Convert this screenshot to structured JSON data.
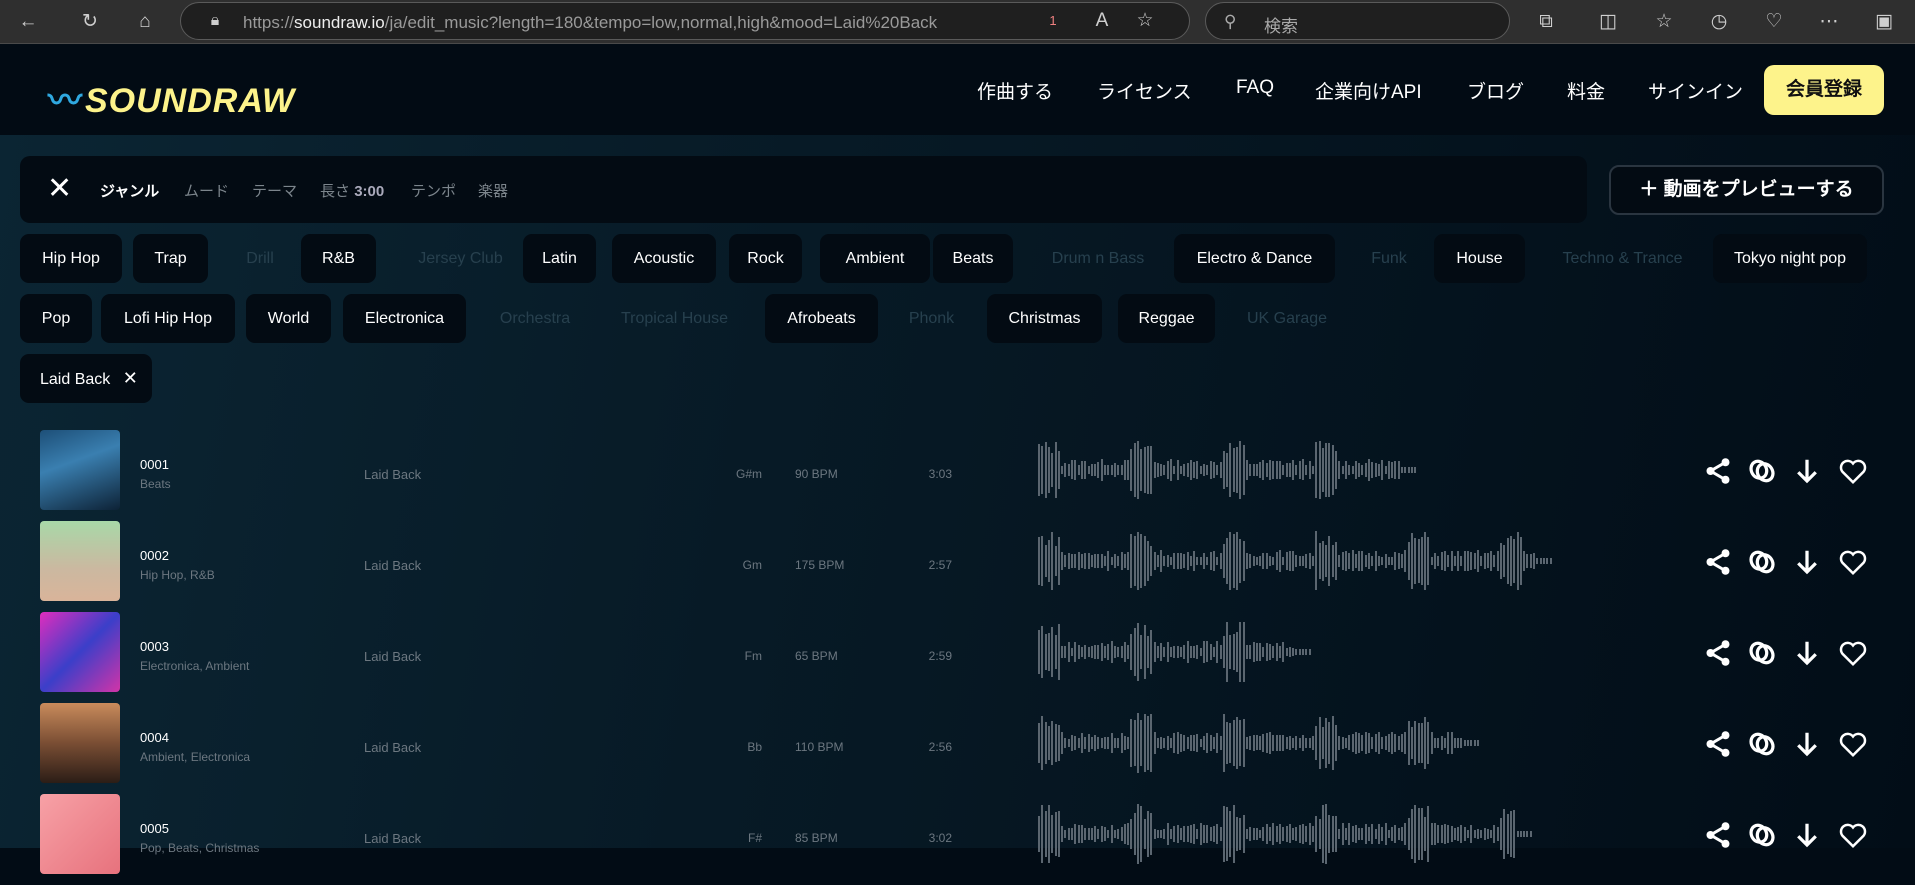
{
  "browser": {
    "url_host": "soundraw.io",
    "url_prefix": "https://",
    "url_path": "/ja/edit_music?length=180&tempo=low,normal,high&mood=Laid%20Back",
    "search_placeholder": "検索",
    "badge": "1"
  },
  "header": {
    "logo": "SOUNDRAW",
    "nav": [
      "作曲する",
      "ライセンス",
      "FAQ",
      "企業向けAPI",
      "ブログ",
      "料金",
      "サインイン"
    ],
    "signup": "会員登録",
    "accent": "#fdf38b"
  },
  "filters": {
    "tabs": [
      "ジャンル",
      "ムード",
      "テーマ",
      "長さ",
      "テンポ",
      "楽器"
    ],
    "length_value": "3:00",
    "preview": "動画をプレビューする"
  },
  "genres": [
    {
      "label": "Hip Hop",
      "enabled": true
    },
    {
      "label": "Trap",
      "enabled": true
    },
    {
      "label": "Drill",
      "enabled": false
    },
    {
      "label": "R&B",
      "enabled": true
    },
    {
      "label": "Jersey Club",
      "enabled": false
    },
    {
      "label": "Latin",
      "enabled": true
    },
    {
      "label": "Acoustic",
      "enabled": true
    },
    {
      "label": "Rock",
      "enabled": true
    },
    {
      "label": "Ambient",
      "enabled": true
    },
    {
      "label": "Beats",
      "enabled": true
    },
    {
      "label": "Drum n Bass",
      "enabled": false
    },
    {
      "label": "Electro & Dance",
      "enabled": true
    },
    {
      "label": "Funk",
      "enabled": false
    },
    {
      "label": "House",
      "enabled": true
    },
    {
      "label": "Techno & Trance",
      "enabled": false
    },
    {
      "label": "Tokyo night pop",
      "enabled": true
    },
    {
      "label": "Pop",
      "enabled": true
    },
    {
      "label": "Lofi Hip Hop",
      "enabled": true
    },
    {
      "label": "World",
      "enabled": true
    },
    {
      "label": "Electronica",
      "enabled": true
    },
    {
      "label": "Orchestra",
      "enabled": false
    },
    {
      "label": "Tropical House",
      "enabled": false
    },
    {
      "label": "Afrobeats",
      "enabled": true
    },
    {
      "label": "Phonk",
      "enabled": false
    },
    {
      "label": "Christmas",
      "enabled": true
    },
    {
      "label": "Reggae",
      "enabled": true
    },
    {
      "label": "UK Garage",
      "enabled": false
    }
  ],
  "selected_mood": "Laid Back",
  "tracks": [
    {
      "id": "0001",
      "genres": "Beats",
      "mood": "Laid Back",
      "key": "G#m",
      "bpm": "90 BPM",
      "duration": "3:03"
    },
    {
      "id": "0002",
      "genres": "Hip Hop, R&B",
      "mood": "Laid Back",
      "key": "Gm",
      "bpm": "175 BPM",
      "duration": "2:57"
    },
    {
      "id": "0003",
      "genres": "Electronica, Ambient",
      "mood": "Laid Back",
      "key": "Fm",
      "bpm": "65 BPM",
      "duration": "2:59"
    },
    {
      "id": "0004",
      "genres": "Ambient, Electronica",
      "mood": "Laid Back",
      "key": "Bb",
      "bpm": "110 BPM",
      "duration": "2:56"
    },
    {
      "id": "0005",
      "genres": "Pop, Beats, Christmas",
      "mood": "Laid Back",
      "key": "F#",
      "bpm": "85 BPM",
      "duration": "3:02"
    }
  ]
}
